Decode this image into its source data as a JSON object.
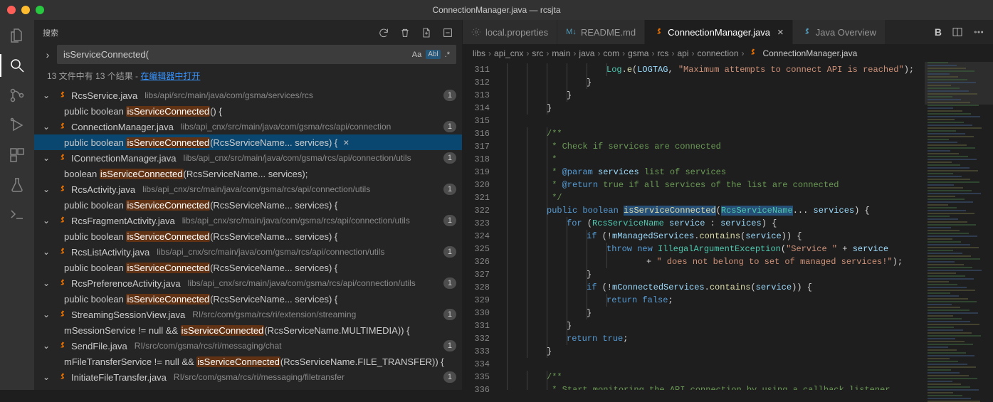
{
  "window": {
    "title": "ConnectionManager.java — rcsjta"
  },
  "search": {
    "label": "搜索",
    "query": "isServiceConnected(",
    "icons": {
      "aa": "Aa",
      "word": "Abl",
      "regex": ".*"
    },
    "summary_prefix": "13 文件中有 13 个结果 - ",
    "summary_link": "在编辑器中打开"
  },
  "results": [
    {
      "file": "RcsService.java",
      "path": "libs/api/src/main/java/com/gsma/services/rcs",
      "count": "1",
      "lines": [
        {
          "pre": "public boolean ",
          "match": "isServiceConnected",
          "post": "() {"
        }
      ]
    },
    {
      "file": "ConnectionManager.java",
      "path": "libs/api_cnx/src/main/java/com/gsma/rcs/api/connection",
      "count": "1",
      "selected": true,
      "lines": [
        {
          "pre": "public boolean ",
          "match": "isServiceConnected",
          "post": "(RcsServiceName... services) {",
          "selected": true,
          "dismiss": true
        }
      ]
    },
    {
      "file": "IConnectionManager.java",
      "path": "libs/api_cnx/src/main/java/com/gsma/rcs/api/connection/utils",
      "count": "1",
      "lines": [
        {
          "pre": "boolean ",
          "match": "isServiceConnected",
          "post": "(RcsServiceName... services);"
        }
      ]
    },
    {
      "file": "RcsActivity.java",
      "path": "libs/api_cnx/src/main/java/com/gsma/rcs/api/connection/utils",
      "count": "1",
      "lines": [
        {
          "pre": "public boolean ",
          "match": "isServiceConnected",
          "post": "(RcsServiceName... services) {"
        }
      ]
    },
    {
      "file": "RcsFragmentActivity.java",
      "path": "libs/api_cnx/src/main/java/com/gsma/rcs/api/connection/utils",
      "count": "1",
      "lines": [
        {
          "pre": "public boolean ",
          "match": "isServiceConnected",
          "post": "(RcsServiceName... services) {"
        }
      ]
    },
    {
      "file": "RcsListActivity.java",
      "path": "libs/api_cnx/src/main/java/com/gsma/rcs/api/connection/utils",
      "count": "1",
      "lines": [
        {
          "pre": "public boolean ",
          "match": "isServiceConnected",
          "post": "(RcsServiceName... services) {"
        }
      ]
    },
    {
      "file": "RcsPreferenceActivity.java",
      "path": "libs/api_cnx/src/main/java/com/gsma/rcs/api/connection/utils",
      "count": "1",
      "lines": [
        {
          "pre": "public boolean ",
          "match": "isServiceConnected",
          "post": "(RcsServiceName... services) {"
        }
      ]
    },
    {
      "file": "StreamingSessionView.java",
      "path": "RI/src/com/gsma/rcs/ri/extension/streaming",
      "count": "1",
      "lines": [
        {
          "pre": "mSessionService != null && ",
          "match": "isServiceConnected",
          "post": "(RcsServiceName.MULTIMEDIA)) {"
        }
      ]
    },
    {
      "file": "SendFile.java",
      "path": "RI/src/com/gsma/rcs/ri/messaging/chat",
      "count": "1",
      "lines": [
        {
          "pre": "mFileTransferService != null && ",
          "match": "isServiceConnected",
          "post": "(RcsServiceName.FILE_TRANSFER)) {"
        }
      ]
    },
    {
      "file": "InitiateFileTransfer.java",
      "path": "RI/src/com/gsma/rcs/ri/messaging/filetransfer",
      "count": "1",
      "lines": []
    }
  ],
  "tabs": [
    {
      "label": "local.properties",
      "icon": "gear"
    },
    {
      "label": "README.md",
      "icon": "md"
    },
    {
      "label": "ConnectionManager.java",
      "icon": "java",
      "active": true,
      "close": true
    },
    {
      "label": "Java Overview",
      "icon": "java-blue"
    }
  ],
  "tabbar_actions": {
    "bold": "B"
  },
  "breadcrumb": [
    "libs",
    "api_cnx",
    "src",
    "main",
    "java",
    "com",
    "gsma",
    "rcs",
    "api",
    "connection",
    "ConnectionManager.java"
  ],
  "editor": {
    "first_line": 311,
    "lines": [
      {
        "indent": 5,
        "segments": [
          {
            "t": "Log",
            "c": "cls"
          },
          {
            "t": ".",
            "c": "white"
          },
          {
            "t": "e",
            "c": "fn"
          },
          {
            "t": "(",
            "c": "white"
          },
          {
            "t": "LOGTAG",
            "c": "prop"
          },
          {
            "t": ", ",
            "c": "white"
          },
          {
            "t": "\"Maximum attempts to connect API is reached\"",
            "c": "str"
          },
          {
            "t": ");",
            "c": "white"
          }
        ]
      },
      {
        "indent": 4,
        "segments": [
          {
            "t": "}",
            "c": "white"
          }
        ]
      },
      {
        "indent": 3,
        "segments": [
          {
            "t": "}",
            "c": "white"
          }
        ]
      },
      {
        "indent": 2,
        "segments": [
          {
            "t": "}",
            "c": "white"
          }
        ]
      },
      {
        "indent": 0,
        "segments": []
      },
      {
        "indent": 2,
        "segments": [
          {
            "t": "/**",
            "c": "cmt"
          }
        ]
      },
      {
        "indent": 2,
        "segments": [
          {
            "t": " * Check if services are connected",
            "c": "cmt"
          }
        ]
      },
      {
        "indent": 2,
        "segments": [
          {
            "t": " *",
            "c": "cmt"
          }
        ]
      },
      {
        "indent": 2,
        "segments": [
          {
            "t": " * ",
            "c": "cmt"
          },
          {
            "t": "@param",
            "c": "doctag"
          },
          {
            "t": " ",
            "c": "cmt"
          },
          {
            "t": "services",
            "c": "param"
          },
          {
            "t": " list of services",
            "c": "cmt"
          }
        ]
      },
      {
        "indent": 2,
        "segments": [
          {
            "t": " * ",
            "c": "cmt"
          },
          {
            "t": "@return",
            "c": "doctag"
          },
          {
            "t": " true if all services of the list are connected",
            "c": "cmt"
          }
        ]
      },
      {
        "indent": 2,
        "segments": [
          {
            "t": " */",
            "c": "cmt"
          }
        ]
      },
      {
        "indent": 2,
        "cur": true,
        "segments": [
          {
            "t": "public",
            "c": "kw"
          },
          {
            "t": " ",
            "c": "white"
          },
          {
            "t": "boolean",
            "c": "kw"
          },
          {
            "t": " ",
            "c": "white"
          },
          {
            "t": "isServiceConnected",
            "c": "fn",
            "sel": true
          },
          {
            "t": "(",
            "c": "white"
          },
          {
            "t": "RcsServiceName",
            "c": "cls",
            "sel": true
          },
          {
            "t": "... ",
            "c": "white"
          },
          {
            "t": "services",
            "c": "param"
          },
          {
            "t": ") {",
            "c": "white"
          }
        ]
      },
      {
        "indent": 3,
        "segments": [
          {
            "t": "for",
            "c": "kw"
          },
          {
            "t": " (",
            "c": "white"
          },
          {
            "t": "RcsServiceName",
            "c": "cls"
          },
          {
            "t": " ",
            "c": "white"
          },
          {
            "t": "service",
            "c": "param"
          },
          {
            "t": " : ",
            "c": "white"
          },
          {
            "t": "services",
            "c": "param"
          },
          {
            "t": ") {",
            "c": "white"
          }
        ]
      },
      {
        "indent": 4,
        "segments": [
          {
            "t": "if",
            "c": "kw"
          },
          {
            "t": " (!",
            "c": "white"
          },
          {
            "t": "mManagedServices",
            "c": "prop"
          },
          {
            "t": ".",
            "c": "white"
          },
          {
            "t": "contains",
            "c": "fn"
          },
          {
            "t": "(",
            "c": "white"
          },
          {
            "t": "service",
            "c": "param"
          },
          {
            "t": ")) {",
            "c": "white"
          }
        ]
      },
      {
        "indent": 5,
        "segments": [
          {
            "t": "throw",
            "c": "kw"
          },
          {
            "t": " ",
            "c": "white"
          },
          {
            "t": "new",
            "c": "kw"
          },
          {
            "t": " ",
            "c": "white"
          },
          {
            "t": "IllegalArgumentException",
            "c": "cls"
          },
          {
            "t": "(",
            "c": "white"
          },
          {
            "t": "\"Service \"",
            "c": "str"
          },
          {
            "t": " + ",
            "c": "white"
          },
          {
            "t": "service",
            "c": "param"
          }
        ]
      },
      {
        "indent": 7,
        "segments": [
          {
            "t": "+ ",
            "c": "white"
          },
          {
            "t": "\" does not belong to set of managed services!\"",
            "c": "str"
          },
          {
            "t": ");",
            "c": "white"
          }
        ]
      },
      {
        "indent": 4,
        "segments": [
          {
            "t": "}",
            "c": "white"
          }
        ]
      },
      {
        "indent": 4,
        "segments": [
          {
            "t": "if",
            "c": "kw"
          },
          {
            "t": " (!",
            "c": "white"
          },
          {
            "t": "mConnectedServices",
            "c": "prop"
          },
          {
            "t": ".",
            "c": "white"
          },
          {
            "t": "contains",
            "c": "fn"
          },
          {
            "t": "(",
            "c": "white"
          },
          {
            "t": "service",
            "c": "param"
          },
          {
            "t": ")) {",
            "c": "white"
          }
        ]
      },
      {
        "indent": 5,
        "segments": [
          {
            "t": "return",
            "c": "kw"
          },
          {
            "t": " ",
            "c": "white"
          },
          {
            "t": "false",
            "c": "const"
          },
          {
            "t": ";",
            "c": "white"
          }
        ]
      },
      {
        "indent": 4,
        "segments": [
          {
            "t": "}",
            "c": "white"
          }
        ]
      },
      {
        "indent": 3,
        "segments": [
          {
            "t": "}",
            "c": "white"
          }
        ]
      },
      {
        "indent": 3,
        "segments": [
          {
            "t": "return",
            "c": "kw"
          },
          {
            "t": " ",
            "c": "white"
          },
          {
            "t": "true",
            "c": "const"
          },
          {
            "t": ";",
            "c": "white"
          }
        ]
      },
      {
        "indent": 2,
        "segments": [
          {
            "t": "}",
            "c": "white"
          }
        ]
      },
      {
        "indent": 0,
        "segments": []
      },
      {
        "indent": 2,
        "segments": [
          {
            "t": "/**",
            "c": "cmt"
          }
        ]
      },
      {
        "indent": 2,
        "segments": [
          {
            "t": " * Start monitoring the API connection by using a callback listener",
            "c": "cmt"
          }
        ]
      }
    ]
  }
}
